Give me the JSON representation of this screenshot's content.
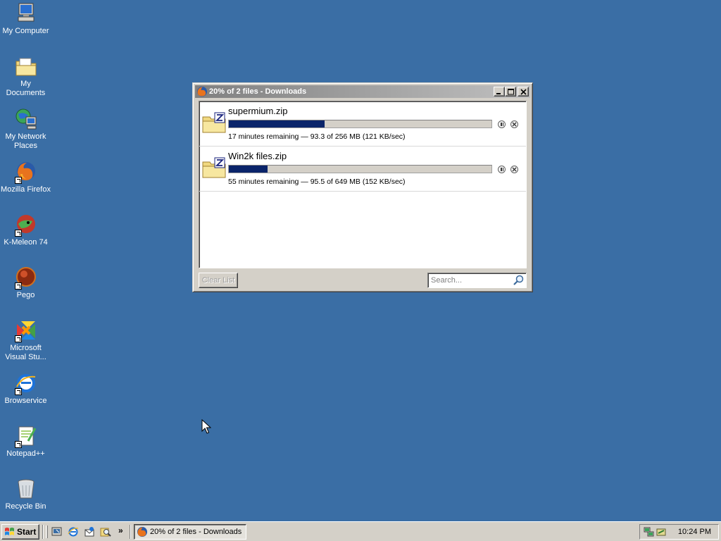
{
  "desktop": {
    "icons": [
      {
        "label": "My Computer",
        "icon": "computer-icon"
      },
      {
        "label": "My Documents",
        "icon": "folder-documents-icon"
      },
      {
        "label": "My Network Places",
        "icon": "network-places-icon"
      },
      {
        "label": "Mozilla Firefox",
        "icon": "firefox-icon"
      },
      {
        "label": "K-Meleon 74",
        "icon": "kmeleon-icon"
      },
      {
        "label": "Pego",
        "icon": "pego-icon"
      },
      {
        "label": "Microsoft Visual Stu...",
        "icon": "visual-studio-icon"
      },
      {
        "label": "Browservice",
        "icon": "browservice-icon"
      },
      {
        "label": "Notepad++",
        "icon": "notepad-plus-plus-icon"
      },
      {
        "label": "Recycle Bin",
        "icon": "recycle-bin-icon"
      }
    ]
  },
  "window": {
    "title": "20% of 2 files - Downloads",
    "downloads": [
      {
        "filename": "supermium.zip",
        "status": "17 minutes remaining — 93.3 of 256 MB (121 KB/sec)",
        "progress": 0.364
      },
      {
        "filename": "Win2k files.zip",
        "status": "55 minutes remaining — 95.5 of 649 MB (152 KB/sec)",
        "progress": 0.147
      }
    ],
    "clear_list_label": "Clear List",
    "search_placeholder": "Search..."
  },
  "taskbar": {
    "start_label": "Start",
    "overflow_label": "»",
    "task_label": "20% of 2 files - Downloads",
    "clock": "10:24 PM"
  },
  "colors": {
    "desktop": "#3a6ea5",
    "progress_fill": "#0a246a",
    "inactive_title": "#808080"
  }
}
